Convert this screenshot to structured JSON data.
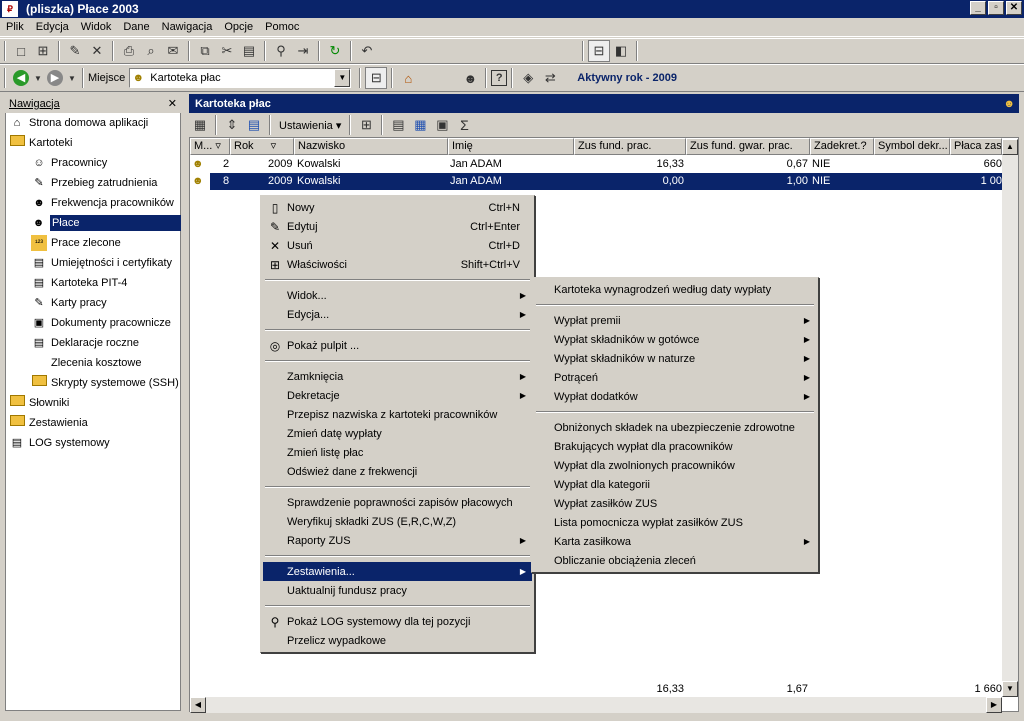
{
  "window": {
    "title": "(pliszka)  Płace 2003",
    "min": "_",
    "max": "▫",
    "close": "✕"
  },
  "menubar": [
    "Plik",
    "Edycja",
    "Widok",
    "Dane",
    "Nawigacja",
    "Opcje",
    "Pomoc"
  ],
  "addressbar": {
    "label": "Miejsce",
    "location": "Kartoteka płac",
    "active_year": "Aktywny rok - 2009"
  },
  "nav": {
    "title": "Nawigacja",
    "close": "✕",
    "items": [
      {
        "label": "Strona domowa aplikacji",
        "level": 0,
        "icon": "home-icon"
      },
      {
        "label": "Kartoteki",
        "level": 0,
        "icon": "folder-icon"
      },
      {
        "label": "Pracownicy",
        "level": 1,
        "icon": "employees-icon"
      },
      {
        "label": "Przebieg zatrudnienia",
        "level": 1,
        "icon": "employment-icon"
      },
      {
        "label": "Frekwencja pracowników",
        "level": 1,
        "icon": "attendance-icon"
      },
      {
        "label": "Płace",
        "level": 1,
        "icon": "payroll-icon",
        "selected": true
      },
      {
        "label": "Prace zlecone",
        "level": 1,
        "icon": "contract-icon"
      },
      {
        "label": "Umiejętności i certyfikaty",
        "level": 1,
        "icon": "certificate-icon"
      },
      {
        "label": "Kartoteka PIT-4",
        "level": 1,
        "icon": "pit4-icon"
      },
      {
        "label": "Karty pracy",
        "level": 1,
        "icon": "workcard-icon"
      },
      {
        "label": "Dokumenty pracownicze",
        "level": 1,
        "icon": "documents-icon"
      },
      {
        "label": "Deklaracje roczne",
        "level": 1,
        "icon": "declaration-icon"
      },
      {
        "label": "Zlecenia kosztowe",
        "level": 1,
        "icon": "none"
      },
      {
        "label": "Skrypty systemowe (SSH)",
        "level": 1,
        "icon": "folder-icon"
      },
      {
        "label": "Słowniki",
        "level": 0,
        "icon": "folder-icon"
      },
      {
        "label": "Zestawienia",
        "level": 0,
        "icon": "folder-icon"
      },
      {
        "label": "LOG systemowy",
        "level": 0,
        "icon": "log-icon"
      }
    ]
  },
  "main": {
    "title": "Kartoteka płac",
    "settings": "Ustawienia",
    "sigma": "Σ"
  },
  "grid": {
    "columns": [
      "M...",
      "Rok",
      "Nazwisko",
      "Imię",
      "Zus fund. prac.",
      "Zus fund. gwar. prac.",
      "Zadekret.?",
      "Symbol dekr...",
      "Płaca zasa..."
    ],
    "rows": [
      {
        "m": "2",
        "rok": "2009",
        "nazwisko": "Kowalski",
        "imie": "Jan ADAM",
        "zus": "16,33",
        "zusg": "0,67",
        "dek": "NIE",
        "sym": "",
        "placa": "660"
      },
      {
        "m": "8",
        "rok": "2009",
        "nazwisko": "Kowalski",
        "imie": "Jan ADAM",
        "zus": "0,00",
        "zusg": "1,00",
        "dek": "NIE",
        "sym": "",
        "placa": "1 00"
      }
    ],
    "totals": {
      "zus": "16,33",
      "zusg": "1,67",
      "placa": "1 660"
    }
  },
  "context_menu": [
    {
      "label": "Nowy",
      "shortcut": "Ctrl+N",
      "icon": "new-icon"
    },
    {
      "label": "Edytuj",
      "shortcut": "Ctrl+Enter",
      "icon": "edit-icon"
    },
    {
      "label": "Usuń",
      "shortcut": "Ctrl+D",
      "icon": "delete-icon"
    },
    {
      "label": "Właściwości",
      "shortcut": "Shift+Ctrl+V",
      "icon": "properties-icon"
    },
    {
      "sep": true
    },
    {
      "label": "Widok...",
      "submenu": true
    },
    {
      "label": "Edycja...",
      "submenu": true
    },
    {
      "sep": true
    },
    {
      "label": "Pokaż pulpit ...",
      "icon": "desktop-icon"
    },
    {
      "sep": true
    },
    {
      "label": "Zamknięcia",
      "submenu": true
    },
    {
      "label": "Dekretacje",
      "submenu": true
    },
    {
      "label": "Przepisz nazwiska z kartoteki pracowników"
    },
    {
      "label": "Zmień datę wypłaty"
    },
    {
      "label": "Zmień listę płac"
    },
    {
      "label": "Odśwież dane z frekwencji"
    },
    {
      "sep": true
    },
    {
      "label": "Sprawdzenie poprawności zapisów płacowych"
    },
    {
      "label": "Weryfikuj składki ZUS (E,R,C,W,Z)"
    },
    {
      "label": "Raporty ZUS",
      "submenu": true
    },
    {
      "sep": true
    },
    {
      "label": "Zestawienia...",
      "submenu": true,
      "highlighted": true
    },
    {
      "label": "Uaktualnij fundusz pracy"
    },
    {
      "sep": true
    },
    {
      "label": "Pokaż LOG systemowy dla tej pozycji",
      "icon": "search-icon"
    },
    {
      "label": "Przelicz wypadkowe"
    }
  ],
  "submenu": [
    {
      "label": "Kartoteka wynagrodzeń według daty wypłaty"
    },
    {
      "sep": true
    },
    {
      "label": "Wypłat premii",
      "submenu": true
    },
    {
      "label": "Wypłat składników w gotówce",
      "submenu": true
    },
    {
      "label": "Wypłat składników w naturze",
      "submenu": true
    },
    {
      "label": "Potrąceń",
      "submenu": true
    },
    {
      "label": "Wypłat dodatków",
      "submenu": true
    },
    {
      "sep": true
    },
    {
      "label": "Obniżonych składek na ubezpieczenie zdrowotne"
    },
    {
      "label": "Brakujących wypłat dla pracowników"
    },
    {
      "label": "Wypłat dla zwolnionych pracowników"
    },
    {
      "label": "Wypłat dla kategorii"
    },
    {
      "label": "Wypłat zasiłków ZUS"
    },
    {
      "label": "Lista pomocnicza wypłat zasiłków ZUS"
    },
    {
      "label": "Karta zasiłkowa",
      "submenu": true
    },
    {
      "label": "Obliczanie obciążenia zleceń"
    }
  ]
}
